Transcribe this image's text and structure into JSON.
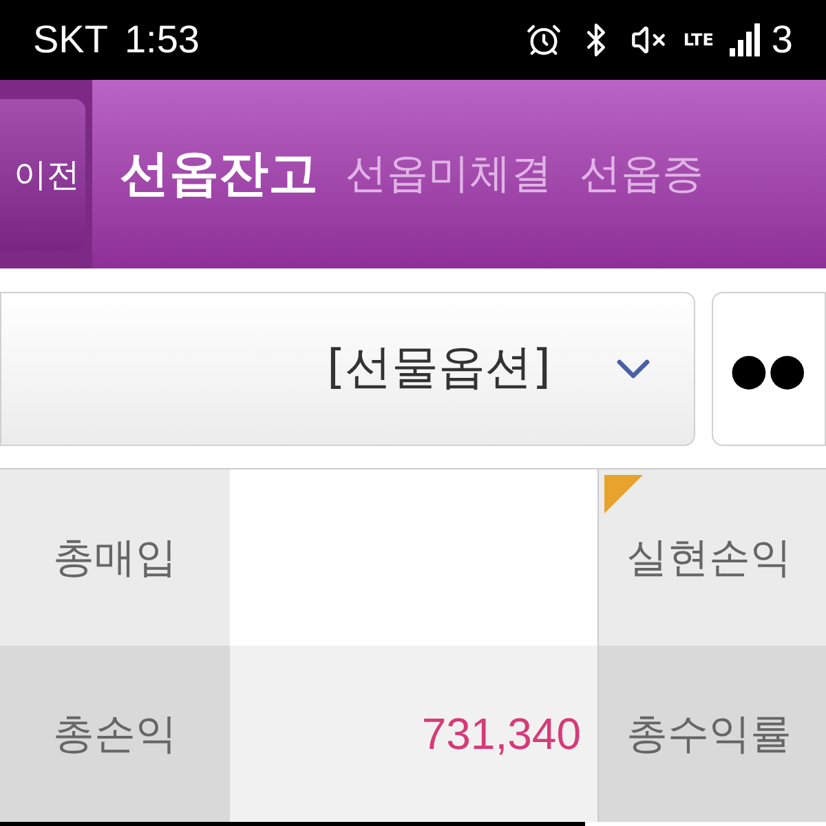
{
  "status_bar": {
    "carrier": "SKT",
    "time": "1:53",
    "network": "LTE",
    "battery": "3"
  },
  "header": {
    "back_button": "이전",
    "tabs": [
      {
        "label": "선옵잔고",
        "selected": true
      },
      {
        "label": "선옵미체결",
        "selected": false
      },
      {
        "label": "선옵증",
        "selected": false
      }
    ]
  },
  "account_select": {
    "value": "[선물옵션]"
  },
  "password_field": {
    "value": "●●"
  },
  "summary": {
    "rows": [
      {
        "label": "총매입",
        "value": "",
        "label_2": "실현손익",
        "flagged": true
      },
      {
        "label": "총손익",
        "value": "731,340",
        "label_2": "총수익률",
        "flagged": false
      }
    ]
  }
}
